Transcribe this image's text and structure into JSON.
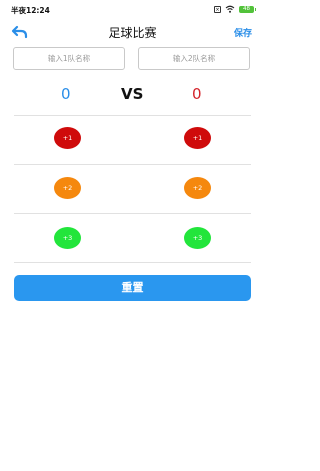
{
  "status_bar": {
    "time": "半夜12:24",
    "battery": "48"
  },
  "navbar": {
    "title": "足球比赛",
    "save_label": "保存"
  },
  "team_inputs": {
    "team1_placeholder": "输入1队名称",
    "team2_placeholder": "输入2队名称",
    "team1_value": "",
    "team2_value": ""
  },
  "scoreboard": {
    "team1_score": "0",
    "vs_label": "VS",
    "team2_score": "0"
  },
  "score_buttons": [
    {
      "label": "+1",
      "color": "#cf0b0b"
    },
    {
      "label": "+2",
      "color": "#f5880e"
    },
    {
      "label": "+3",
      "color": "#22e53b"
    }
  ],
  "reset_label": "重置",
  "colors": {
    "accent": "#2a8ee8",
    "team2_score": "#d4232a"
  }
}
